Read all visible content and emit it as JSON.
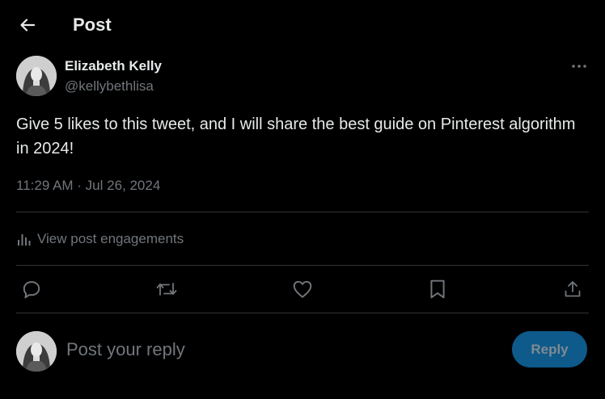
{
  "header": {
    "back_icon": "back-arrow-icon",
    "title": "Post"
  },
  "post": {
    "author": {
      "name": "Elizabeth Kelly",
      "handle": "@kellybethlisa",
      "avatar_icon": "avatar-photo"
    },
    "more_icon": "more-options-icon",
    "text": "Give 5 likes to this tweet, and I will share the best guide on Pinterest algorithm in 2024!",
    "timestamp": "11:29 AM · Jul 26, 2024",
    "engagements_label": "View post engagements",
    "engagements_icon": "analytics-icon",
    "actions": [
      {
        "name": "reply",
        "icon": "comment-icon"
      },
      {
        "name": "repost",
        "icon": "repost-icon"
      },
      {
        "name": "like",
        "icon": "heart-icon"
      },
      {
        "name": "bookmark",
        "icon": "bookmark-icon"
      },
      {
        "name": "share",
        "icon": "share-icon"
      }
    ]
  },
  "composer": {
    "placeholder": "Post your reply",
    "value": "",
    "reply_button_label": "Reply"
  },
  "colors": {
    "background": "#000000",
    "text_primary": "#e7e9ea",
    "text_secondary": "#71767b",
    "divider": "#2f3336",
    "reply_button_bg": "#0e5a8a",
    "reply_button_text": "#7f8a92"
  }
}
